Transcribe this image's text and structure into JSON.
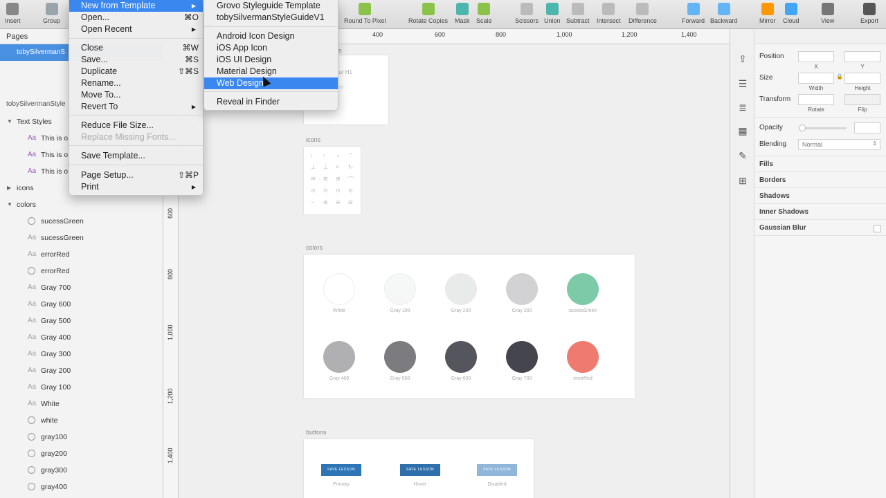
{
  "toolbar": {
    "items": [
      {
        "label": "Insert",
        "color": "#888888"
      },
      {
        "label": "Group",
        "color": "#9aa4ad"
      },
      {
        "label": "Round To Pixel",
        "color": "#8bc34a"
      },
      {
        "label": "Rotate Copies",
        "color": "#8bc34a"
      },
      {
        "label": "Mask",
        "color": "#4db6ac"
      },
      {
        "label": "Scale",
        "color": "#8bc34a"
      },
      {
        "label": "Scissors",
        "color": "#bbbbbb"
      },
      {
        "label": "Union",
        "color": "#4db6ac"
      },
      {
        "label": "Subtract",
        "color": "#bbbbbb"
      },
      {
        "label": "Intersect",
        "color": "#bbbbbb"
      },
      {
        "label": "Difference",
        "color": "#bbbbbb"
      },
      {
        "label": "Forward",
        "color": "#64b5f6"
      },
      {
        "label": "Backward",
        "color": "#64b5f6"
      },
      {
        "label": "Mirror",
        "color": "#ff9800"
      },
      {
        "label": "Cloud",
        "color": "#42a5f5"
      },
      {
        "label": "View",
        "color": "#777777"
      },
      {
        "label": "Export",
        "color": "#555555"
      }
    ]
  },
  "left_panel": {
    "pages_header": "Pages",
    "selected_page": "tobySilvermanS",
    "artboard_title": "tobySilvermanStyle",
    "layers": [
      {
        "type": "group",
        "name": "Text Styles",
        "expanded": true
      },
      {
        "type": "text-style",
        "name": "This is o",
        "icon": "Aa",
        "purple": true
      },
      {
        "type": "text-style",
        "name": "This is o",
        "icon": "Aa",
        "purple": true
      },
      {
        "type": "text-style",
        "name": "This is o",
        "icon": "Aa",
        "purple": true
      },
      {
        "type": "group",
        "name": "icons",
        "expanded": false
      },
      {
        "type": "group",
        "name": "colors",
        "expanded": true
      },
      {
        "type": "shape",
        "name": "sucessGreen"
      },
      {
        "type": "text",
        "name": "sucessGreen"
      },
      {
        "type": "text",
        "name": "errorRed"
      },
      {
        "type": "shape",
        "name": "errorRed"
      },
      {
        "type": "text",
        "name": "Gray 700"
      },
      {
        "type": "text",
        "name": "Gray 600"
      },
      {
        "type": "text",
        "name": "Gray 500"
      },
      {
        "type": "text",
        "name": "Gray 400"
      },
      {
        "type": "text",
        "name": "Gray 300"
      },
      {
        "type": "text",
        "name": "Gray 200"
      },
      {
        "type": "text",
        "name": "Gray 100"
      },
      {
        "type": "text",
        "name": "White"
      },
      {
        "type": "shape",
        "name": "white"
      },
      {
        "type": "shape",
        "name": "gray100"
      },
      {
        "type": "shape",
        "name": "gray200"
      },
      {
        "type": "shape",
        "name": "gray300"
      },
      {
        "type": "shape",
        "name": "gray400"
      }
    ]
  },
  "rulers": {
    "top_ticks": [
      "400",
      "600",
      "800",
      "1,000",
      "1,200",
      "1,400"
    ],
    "left_ticks": [
      "600",
      "800",
      "1,000",
      "1,200",
      "1,400"
    ]
  },
  "canvas": {
    "partial_artboard_labels": [
      "s",
      "our H1",
      "H2"
    ],
    "icons_label": "icons",
    "colors_label": "colors",
    "buttons_label": "buttons",
    "swatches": [
      {
        "label": "White",
        "color": "#ffffff"
      },
      {
        "label": "Gray 100",
        "color": "#f6f7f7"
      },
      {
        "label": "Gray 200",
        "color": "#e9eaea"
      },
      {
        "label": "Gray 300",
        "color": "#d2d2d4"
      },
      {
        "label": "sucessGreen",
        "color": "#7dcaa8"
      },
      {
        "label": "Gray 400",
        "color": "#b0b0b2"
      },
      {
        "label": "Gray 500",
        "color": "#7b7b80"
      },
      {
        "label": "Gray 600",
        "color": "#55555d"
      },
      {
        "label": "Gray 700",
        "color": "#45454e"
      },
      {
        "label": "errorRed",
        "color": "#ef7b70"
      }
    ],
    "buttons": [
      {
        "text": "SAVE LESSON",
        "caption": "Primary",
        "color": "#2e75b6"
      },
      {
        "text": "SAVE LESSON",
        "caption": "Hover",
        "color": "#2f6fac"
      },
      {
        "text": "SAVE LESSON",
        "caption": "Disabled",
        "color": "#90b6d9"
      }
    ]
  },
  "inspector": {
    "position": "Position",
    "x": "X",
    "y": "Y",
    "size": "Size",
    "width": "Width",
    "height": "Height",
    "transform": "Transform",
    "rotate": "Rotate",
    "flip": "Flip",
    "opacity": "Opacity",
    "blending": "Blending",
    "blending_value": "Normal",
    "fills": "Fills",
    "borders": "Borders",
    "shadows": "Shadows",
    "inner_shadows": "Inner Shadows",
    "gaussian_blur": "Gaussian Blur"
  },
  "file_menu": {
    "items": [
      {
        "label": "New from Template",
        "shortcut": "",
        "submenu": true,
        "highlighted": true,
        "disabled": false
      },
      {
        "label": "Open...",
        "shortcut": "⌘O",
        "submenu": false,
        "highlighted": false,
        "disabled": false
      },
      {
        "label": "Open Recent",
        "shortcut": "",
        "submenu": true,
        "highlighted": false,
        "disabled": false
      },
      {
        "label": "Close",
        "shortcut": "⌘W",
        "submenu": false,
        "highlighted": false,
        "disabled": false
      },
      {
        "label": "Save...",
        "shortcut": "⌘S",
        "submenu": false,
        "highlighted": false,
        "disabled": false
      },
      {
        "label": "Duplicate",
        "shortcut": "⇧⌘S",
        "submenu": false,
        "highlighted": false,
        "disabled": false
      },
      {
        "label": "Rename...",
        "shortcut": "",
        "submenu": false,
        "highlighted": false,
        "disabled": false
      },
      {
        "label": "Move To...",
        "shortcut": "",
        "submenu": false,
        "highlighted": false,
        "disabled": false
      },
      {
        "label": "Revert To",
        "shortcut": "",
        "submenu": true,
        "highlighted": false,
        "disabled": false
      },
      {
        "label": "Reduce File Size...",
        "shortcut": "",
        "submenu": false,
        "highlighted": false,
        "disabled": false
      },
      {
        "label": "Replace Missing Fonts...",
        "shortcut": "",
        "submenu": false,
        "highlighted": false,
        "disabled": true
      },
      {
        "label": "Save Template...",
        "shortcut": "",
        "submenu": false,
        "highlighted": false,
        "disabled": false
      },
      {
        "label": "Page Setup...",
        "shortcut": "⇧⌘P",
        "submenu": false,
        "highlighted": false,
        "disabled": false
      },
      {
        "label": "Print",
        "shortcut": "",
        "submenu": true,
        "highlighted": false,
        "disabled": false
      }
    ]
  },
  "submenu": {
    "items": [
      {
        "label": "Grovo Styleguide Template",
        "highlighted": false
      },
      {
        "label": "tobySilvermanStyleGuideV1",
        "highlighted": false
      },
      {
        "label": "Android Icon Design",
        "highlighted": false
      },
      {
        "label": "iOS App Icon",
        "highlighted": false
      },
      {
        "label": "iOS UI Design",
        "highlighted": false
      },
      {
        "label": "Material Design",
        "highlighted": false
      },
      {
        "label": "Web Design",
        "highlighted": true
      },
      {
        "label": "Reveal in Finder",
        "highlighted": false
      }
    ]
  }
}
